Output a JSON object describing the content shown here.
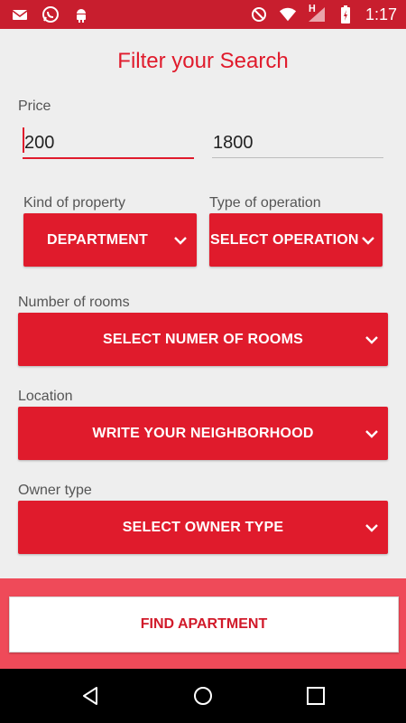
{
  "status_bar": {
    "time": "1:17",
    "left_icons": [
      "mail-icon",
      "whatsapp-icon",
      "android-icon"
    ],
    "right_icons": [
      "do-not-disturb-icon",
      "wifi-icon",
      "signal-icon",
      "battery-icon"
    ],
    "network_label": "H"
  },
  "page": {
    "title": "Filter your Search"
  },
  "price": {
    "label": "Price",
    "min_value": "200",
    "max_value": "1800"
  },
  "kind_property": {
    "label": "Kind of property",
    "selected": "DEPARTMENT"
  },
  "type_operation": {
    "label": "Type of operation",
    "selected": "SELECT OPERATION"
  },
  "rooms": {
    "label": "Number of rooms",
    "selected": "SELECT NUMER OF ROOMS"
  },
  "location": {
    "label": "Location",
    "selected": "WRITE YOUR NEIGHBORHOOD"
  },
  "owner_type": {
    "label": "Owner type",
    "selected": "SELECT OWNER TYPE"
  },
  "actions": {
    "find_label": "FIND APARTMENT"
  },
  "colors": {
    "accent": "#e01b2c",
    "status_bar": "#c81e2e",
    "bottom_bar": "#ef4a59",
    "background": "#eeeeee"
  },
  "nav_bar": {
    "items": [
      "back-icon",
      "home-icon",
      "recents-icon"
    ]
  }
}
